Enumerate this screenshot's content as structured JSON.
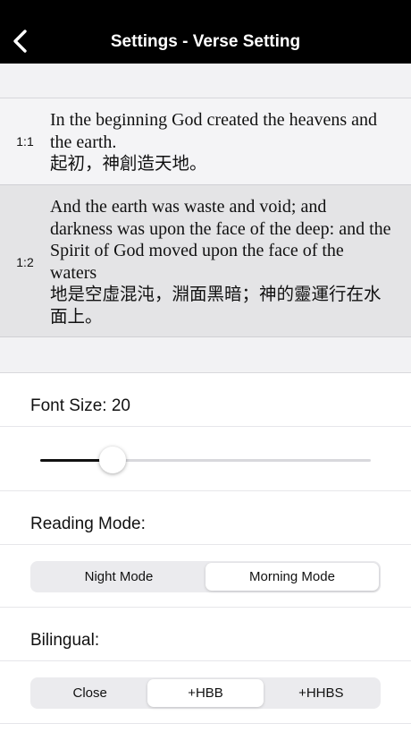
{
  "header": {
    "title": "Settings - Verse Setting",
    "back_icon": "chevron-left-icon"
  },
  "verses": [
    {
      "number": "1:1",
      "english": "In the beginning God created the heavens and the earth.",
      "chinese": "起初，神創造天地。"
    },
    {
      "number": "1:2",
      "english": "And the earth was waste and void; and darkness was upon the face of the deep: and the Spirit of God moved upon the face of the waters",
      "chinese": "地是空虛混沌，淵面黑暗；神的靈運行在水面上。"
    }
  ],
  "font_size": {
    "label": "Font Size: 20",
    "value": 20,
    "slider_fraction": 0.22
  },
  "reading_mode": {
    "label": "Reading Mode:",
    "options": [
      "Night Mode",
      "Morning Mode"
    ],
    "selected": 1
  },
  "bilingual": {
    "label": "Bilingual:",
    "options": [
      "Close",
      "+HBB",
      "+HHBS"
    ],
    "selected": 1
  },
  "colors": {
    "header_bg": "#000000",
    "selected_verse_bg": "#e4e4e6",
    "slider_fill": "#111111"
  }
}
